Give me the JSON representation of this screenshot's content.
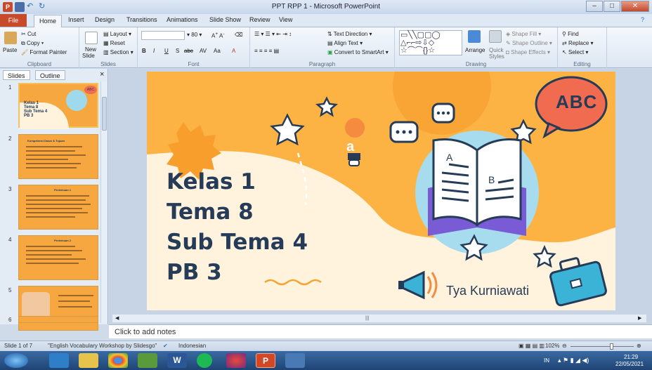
{
  "window": {
    "title": "PPT RPP 1 - Microsoft PowerPoint"
  },
  "tabs": [
    "File",
    "Home",
    "Insert",
    "Design",
    "Transitions",
    "Animations",
    "Slide Show",
    "Review",
    "View"
  ],
  "ribbon": {
    "clipboard": {
      "label": "Clipboard",
      "paste": "Paste",
      "cut": "Cut",
      "copy": "Copy",
      "format_painter": "Format Painter"
    },
    "slides": {
      "label": "Slides",
      "new_slide": "New",
      "new_slide2": "Slide",
      "layout": "Layout",
      "reset": "Reset",
      "section": "Section"
    },
    "font": {
      "label": "Font",
      "size": "80",
      "bold": "B",
      "italic": "I",
      "underline": "U",
      "strike": "S",
      "abc": "abc",
      "av": "AV",
      "aa": "Aa",
      "a_color": "A"
    },
    "paragraph": {
      "label": "Paragraph",
      "text_direction": "Text Direction",
      "align_text": "Align Text",
      "convert": "Convert to SmartArt"
    },
    "drawing": {
      "label": "Drawing",
      "arrange": "Arrange",
      "quick_styles": "Quick",
      "quick_styles2": "Styles",
      "shape_fill": "Shape Fill",
      "shape_outline": "Shape Outline",
      "shape_effects": "Shape Effects"
    },
    "editing": {
      "label": "Editing",
      "find": "Find",
      "replace": "Replace",
      "select": "Select"
    }
  },
  "panel": {
    "tab_slides": "Slides",
    "tab_outline": "Outline",
    "close": "×",
    "thumb1": {
      "n": "1",
      "text": [
        "Kelas 1",
        "Tema 8",
        "Sub Tema 4",
        "PB 3"
      ],
      "abc": "ABC"
    },
    "thumb2": {
      "n": "2",
      "title": "Kompetensi Dasar & Tujuan"
    },
    "thumb3": {
      "n": "3",
      "title": "Pertemuan 1"
    },
    "thumb4": {
      "n": "4",
      "title": "Pertemuan 2"
    },
    "thumb5": {
      "n": "5"
    },
    "thumb6": {
      "n": "6"
    }
  },
  "slide": {
    "line1": "Kelas 1",
    "line2": "Tema 8",
    "line3": "Sub Tema 4",
    "line4": "PB 3",
    "author": "Tya Kurniawati",
    "bubble": "ABC",
    "bulb": "a",
    "book_a": "A",
    "book_b": "B"
  },
  "notes": {
    "placeholder": "Click to add notes"
  },
  "status": {
    "slide": "Slide 1 of 7",
    "theme": "\"English Vocabulary Workshop by Slidesgo\"",
    "lang": "Indonesian",
    "zoom": "102%"
  },
  "taskbar": {
    "lang": "IN",
    "time": "21:29",
    "date": "22/05/2021"
  },
  "colors": {
    "slide_orange": "#fcb344",
    "slide_cream": "#fff3de",
    "title_navy": "#253b57",
    "accent_blue": "#3bb3d6",
    "file_tab": "#c74a2a"
  }
}
